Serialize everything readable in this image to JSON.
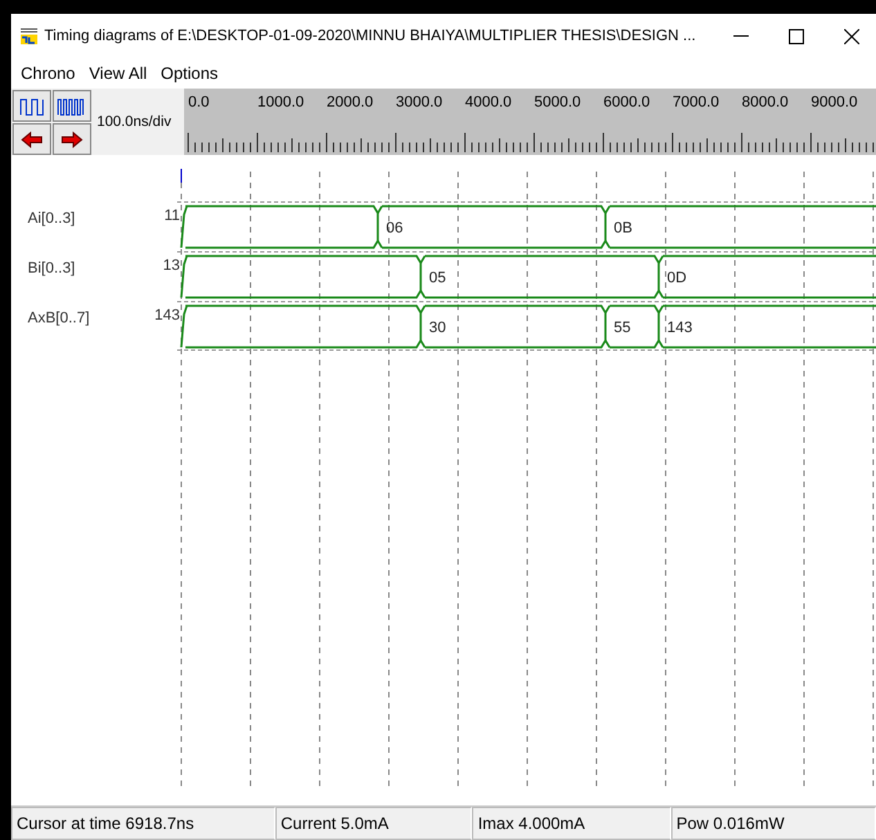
{
  "window": {
    "title": "Timing diagrams of E:\\DESKTOP-01-09-2020\\MINNU BHAIYA\\MULTIPLIER THESIS\\DESIGN ..."
  },
  "menu": [
    "Chrono",
    "View All",
    "Options"
  ],
  "toolbar": {
    "scale": "100.0ns/div"
  },
  "ruler": {
    "labels": [
      "0.0",
      "1000.0",
      "2000.0",
      "3000.0",
      "4000.0",
      "5000.0",
      "6000.0",
      "7000.0",
      "8000.0",
      "9000.0"
    ]
  },
  "signals": [
    {
      "name": "Ai[0..3]",
      "values": [
        "11",
        "06",
        "0B"
      ]
    },
    {
      "name": "Bi[0..3]",
      "values": [
        "13",
        "05",
        "0D"
      ]
    },
    {
      "name": "AxB[0..7]",
      "values": [
        "143",
        "30",
        "55",
        "143"
      ]
    }
  ],
  "status_bar": [
    "Cursor at time 6918.7ns",
    "Current  5.0mA",
    "Imax 4.000mA",
    "Pow 0.016mW"
  ]
}
